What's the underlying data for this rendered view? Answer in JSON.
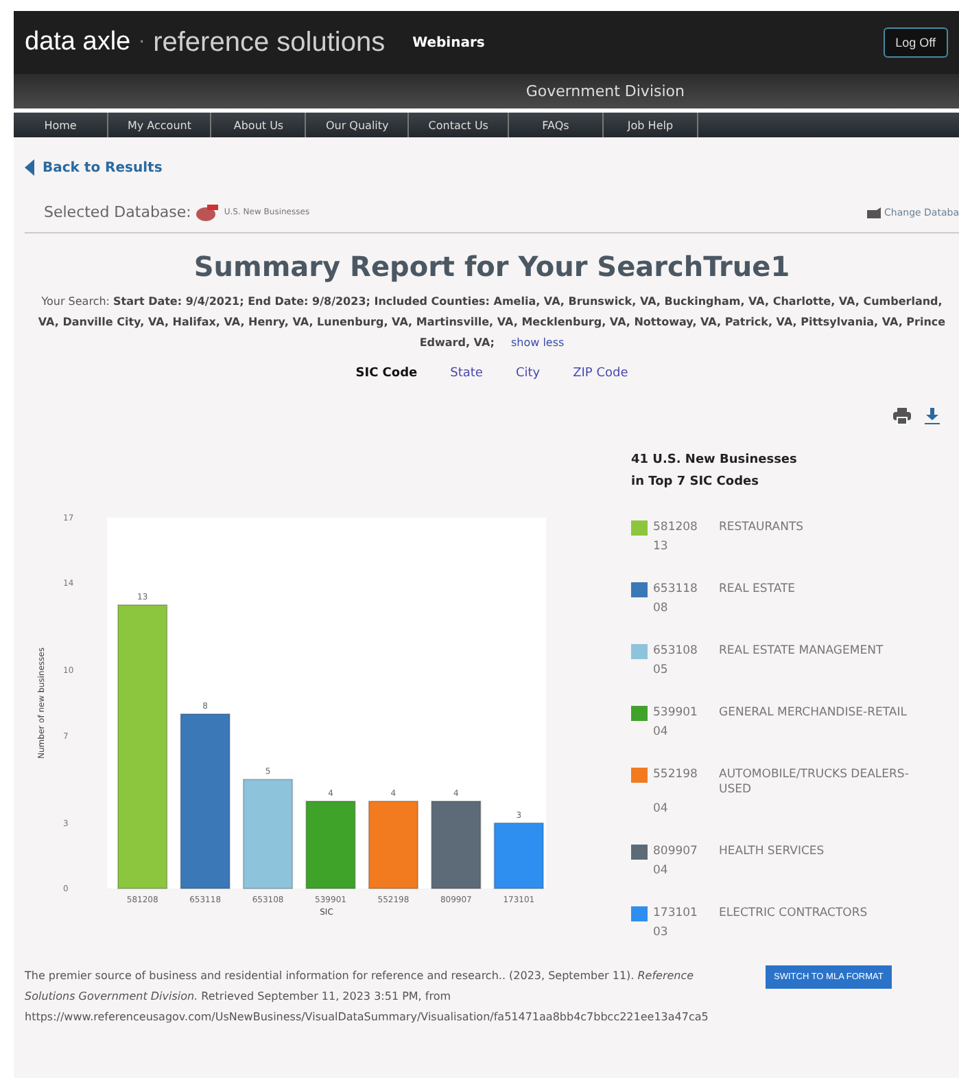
{
  "header": {
    "logo_brand": "data axle",
    "logo_separator": "·",
    "logo_product": "reference solutions",
    "webinars": "Webinars",
    "logoff": "Log Off"
  },
  "division": "Government Division",
  "nav": [
    "Home",
    "My Account",
    "About Us",
    "Our Quality",
    "Contact Us",
    "FAQs",
    "Job Help"
  ],
  "back_link": "Back to Results",
  "database": {
    "label": "Selected Database:",
    "name": "U.S. New Businesses",
    "change": "Change Databa"
  },
  "title": "Summary Report for Your SearchTrue1",
  "search_summary": {
    "text": "Your Search: **Start Date: 9/4/2021; End Date: 9/8/2023; Included Counties: Amelia, VA, Brunswick, VA, Buckingham, VA, Charlotte, VA, Cumberland, VA, Danville City, VA, Halifax, VA, Henry, VA, Lunenburg, VA, Martinsville, VA, Mecklenburg, VA, Nottoway, VA, Patrick, VA, Pittsylvania, VA, Prince Edward, VA;**",
    "toggle": "show less"
  },
  "tabs": [
    {
      "label": "SIC Code",
      "selected": true
    },
    {
      "label": "State",
      "selected": false
    },
    {
      "label": "City",
      "selected": false
    },
    {
      "label": "ZIP Code",
      "selected": false
    }
  ],
  "chart": {
    "chart_data": {
      "type": "bar",
      "xlabel": "SIC",
      "ylabel": "Number of new businesses",
      "categories": [
        "581208",
        "653118",
        "653108",
        "539901",
        "552198",
        "809907",
        "173101"
      ],
      "series": [
        {
          "values": [
            13,
            8,
            5,
            4,
            4,
            4,
            3
          ]
        }
      ],
      "colors": [
        "#8cc63f",
        "#3a78b8",
        "#8ec3dc",
        "#3fa32a",
        "#f27a1f",
        "#5d6b78",
        "#2f8ff0"
      ],
      "ylim": [
        0,
        17
      ],
      "yticks": [
        0,
        3,
        7,
        10,
        14,
        17
      ],
      "data_labels": true
    }
  },
  "legend": {
    "title_1": "41 U.S. New Businesses",
    "title_2": "in Top 7 SIC Codes",
    "items": [
      {
        "code": "581208",
        "name": "RESTAURANTS",
        "count": "13",
        "color": "#8cc63f"
      },
      {
        "code": "653118",
        "name": "REAL ESTATE",
        "count": "08",
        "color": "#3a78b8"
      },
      {
        "code": "653108",
        "name": "REAL ESTATE MANAGEMENT",
        "count": "05",
        "color": "#8ec3dc"
      },
      {
        "code": "539901",
        "name": "GENERAL MERCHANDISE-RETAIL",
        "count": "04",
        "color": "#3fa32a"
      },
      {
        "code": "552198",
        "name": "AUTOMOBILE/TRUCKS DEALERS-USED",
        "count": "04",
        "color": "#f27a1f"
      },
      {
        "code": "809907",
        "name": "HEALTH SERVICES",
        "count": "04",
        "color": "#5d6b78"
      },
      {
        "code": "173101",
        "name": "ELECTRIC CONTRACTORS",
        "count": "03",
        "color": "#2f8ff0"
      }
    ]
  },
  "citation": {
    "text": "The premier source of business and residential information for reference and research.. (2023, September 11). *Reference Solutions Government Division.* Retrieved September 11, 2023 3:51 PM, from",
    "url": "https://www.referenceusagov.com/UsNewBusiness/VisualDataSummary/Visualisation/fa51471aa8bb4c7bbcc221ee13a47ca5",
    "button": "SWITCH TO MLA FORMAT"
  }
}
